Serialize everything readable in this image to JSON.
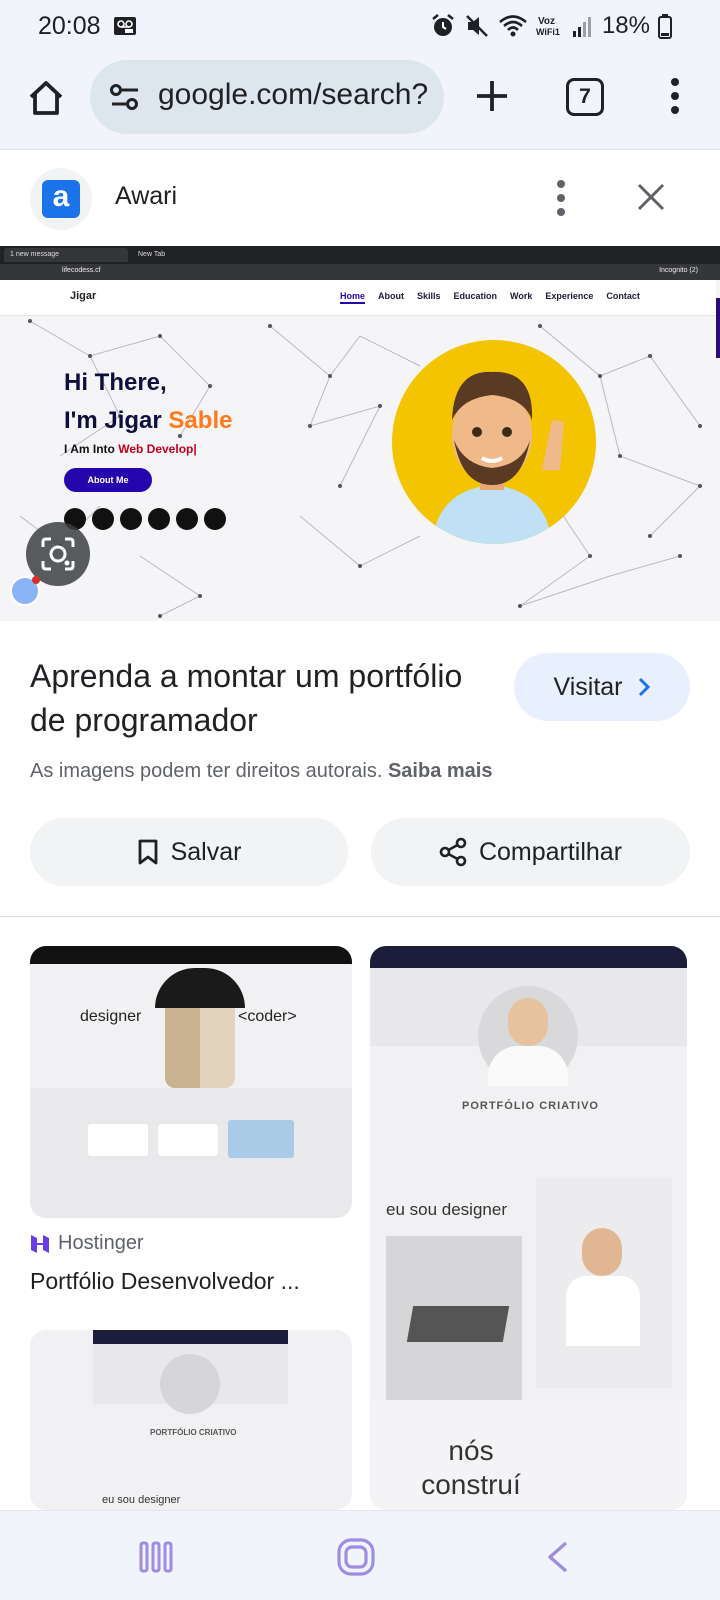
{
  "status_bar": {
    "time": "20:08",
    "battery": "18%",
    "icons": [
      "voicemail-icon",
      "alarm-icon",
      "mute-icon",
      "wifi-icon",
      "vowifi-icon",
      "signal-icon",
      "battery-icon"
    ],
    "vowifi_label": "Voz WiFi1"
  },
  "browser": {
    "url": "google.com/search?",
    "tab_count": "7"
  },
  "source": {
    "favicon_letter": "a",
    "name": "Awari"
  },
  "preview": {
    "browser_tabs": [
      "1 new message",
      "New Tab"
    ],
    "address": "lifecodess.cf",
    "incognito": "Incognito (2)",
    "site_logo": "Jigar",
    "site_nav": [
      "Home",
      "About",
      "Skills",
      "Education",
      "Work",
      "Experience",
      "Contact"
    ],
    "hero_line1": "Hi There,",
    "hero_line2_prefix": "I'm Jigar ",
    "hero_line2_accent": "Sable",
    "hero_sub_prefix": "I Am Into ",
    "hero_sub_accent": "Web Develop|",
    "hero_button": "About Me"
  },
  "result": {
    "title": "Aprenda a montar um portfólio de programador",
    "visit_label": "Visitar",
    "copyright_text": "As imagens podem ter direitos autorais.",
    "copyright_link": "Saiba mais",
    "save_label": "Salvar",
    "share_label": "Compartilhar"
  },
  "related": [
    {
      "source": "Hostinger",
      "title": "Portfólio Desenvolvedor ...",
      "thumb_left_word": "designer",
      "thumb_right_word": "<coder>"
    },
    {
      "thumb_heading": "PORTFÓLIO CRIATIVO",
      "thumb_mid": "eu sou designer",
      "thumb_bottom": "nós construí"
    },
    {
      "thumb_heading": "PORTFÓLIO CRIATIVO",
      "thumb_mid": "eu sou designer"
    }
  ],
  "colors": {
    "accent_blue": "#1a73e8",
    "visit_bg": "#e8f0fe",
    "chrome_bg": "#f1f5fb",
    "hero_accent_orange": "#ff7a1a",
    "hero_button_purple": "#2506ad",
    "nav_icon_purple": "#a08ce0"
  }
}
